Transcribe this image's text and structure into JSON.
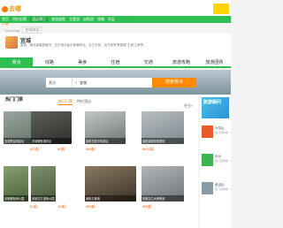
{
  "site": {
    "logo_text": "去哪儿"
  },
  "nav": [
    {
      "label": "首页",
      "active": false
    },
    {
      "label": "特价机票",
      "active": false
    },
    {
      "label": "酒店预订",
      "active": true
    },
    {
      "label": "旅游度假",
      "active": false
    },
    {
      "label": "主题游",
      "active": false
    },
    {
      "label": "自助游",
      "active": false
    },
    {
      "label": "攻略",
      "active": false
    },
    {
      "label": "社区",
      "active": false
    }
  ],
  "breadcrumb": {
    "site": "Travelling",
    "city": "宜城旅游"
  },
  "city": {
    "title": "宜城",
    "intro": "宜城，湖北省辖县级市，位于湖北省中部偏西北，汉江中游，自古就有'楚皇城''王城'之美誉。"
  },
  "tabs": [
    "景点",
    "线路",
    "美食",
    "住宿",
    "交通",
    "旅游攻略",
    "旅游团购"
  ],
  "search": {
    "select_label": "景点",
    "value": "宜城",
    "button": "搜索景点"
  },
  "section": {
    "title": "热门门票",
    "tabs": [
      "热门门票",
      "特价酒店"
    ],
    "more": "更多»"
  },
  "cards": [
    {
      "name": "宜城楚皇城遗址",
      "price": "¥20起",
      "was": ""
    },
    {
      "name": "宜城鲤鱼湖景区",
      "price": "¥0起",
      "was": ""
    },
    {
      "name": "襄阳古隆中风景区",
      "price": "¥86起",
      "was": ""
    },
    {
      "name": "襄阳唐城影视基地",
      "price": "¥104起",
      "was": ""
    },
    {
      "name": "宜城鲤鱼桥公园",
      "price": "¥1起",
      "was": ""
    },
    {
      "name": "宜城汉江湿地公园",
      "price": "¥0起",
      "was": ""
    },
    {
      "name": "襄阳古城墙",
      "price": "¥40起",
      "was": ""
    },
    {
      "name": "宜城汉江大桥夜景",
      "price": "¥96起",
      "was": ""
    }
  ],
  "sidebar": {
    "banner": "旅游顾问",
    "items": [
      {
        "title": "九华山",
        "sub": "热门目的地"
      },
      {
        "title": "长沙",
        "sub": "热门目的地"
      },
      {
        "title": "武当山",
        "sub": "热门目的地"
      }
    ]
  }
}
